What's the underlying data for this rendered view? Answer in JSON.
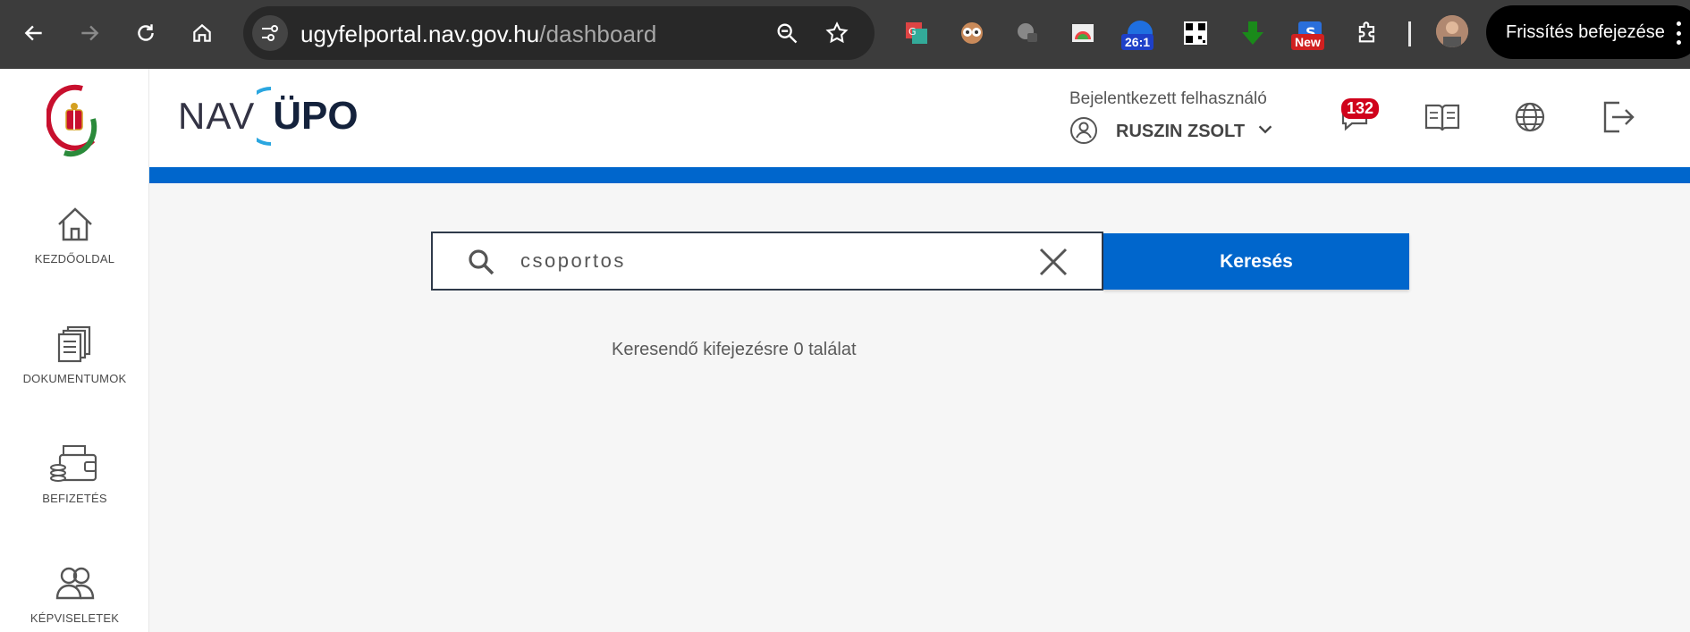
{
  "browser": {
    "url_host": "ugyfelportal.nav.gov.hu",
    "url_path": "/dashboard",
    "update_button": "Frissítés befejezése",
    "extension_badge_count": "26:1",
    "extension_badge_new": "New"
  },
  "app": {
    "logo_left": "NAV",
    "logo_right": "ÜPO"
  },
  "sidebar": {
    "items": [
      {
        "label": "KEZDŐOLDAL"
      },
      {
        "label": "DOKUMENTUMOK"
      },
      {
        "label": "BEFIZETÉS"
      },
      {
        "label": "KÉPVISELETEK"
      }
    ]
  },
  "header": {
    "user_label": "Bejelentkezett felhasználó",
    "user_name": "RUSZIN ZSOLT",
    "messages_count": "132"
  },
  "search": {
    "value": "csoportos",
    "button_label": "Keresés",
    "result_text": "Keresendő kifejezésre 0 találat"
  },
  "colors": {
    "brand_blue": "#0066cc",
    "badge_red": "#d0021b"
  }
}
